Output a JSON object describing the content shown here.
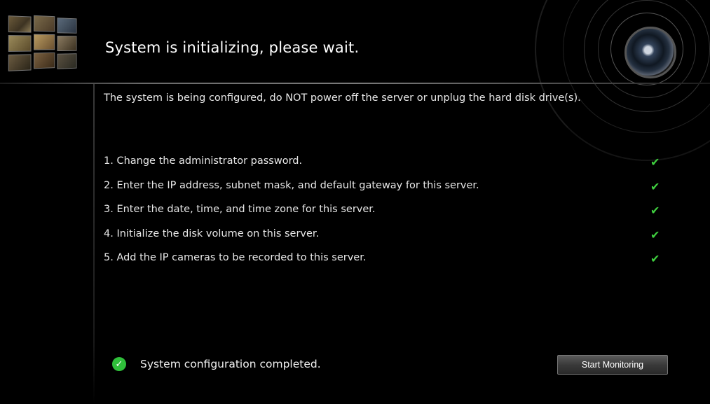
{
  "header": {
    "title": "System is initializing, please wait."
  },
  "warning": "The system is being configured, do NOT power off the server or unplug the hard disk drive(s).",
  "steps": [
    {
      "label": "1. Change the administrator password.",
      "done": true
    },
    {
      "label": "2. Enter the IP address, subnet mask, and default gateway for this server.",
      "done": true
    },
    {
      "label": "3. Enter the date, time, and time zone for this server.",
      "done": true
    },
    {
      "label": "4. Initialize the disk volume on this server.",
      "done": true
    },
    {
      "label": "5. Add the IP cameras to be recorded to this server.",
      "done": true
    }
  ],
  "footer": {
    "status_text": "System configuration completed.",
    "start_button": "Start Monitoring"
  },
  "icons": {
    "step_check": "checkmark-icon",
    "status": "check-circle-icon",
    "logo": "camera-lens-icon"
  },
  "colors": {
    "background": "#000000",
    "check": "#3fcf3f",
    "status_badge": "#2fbf3a"
  }
}
